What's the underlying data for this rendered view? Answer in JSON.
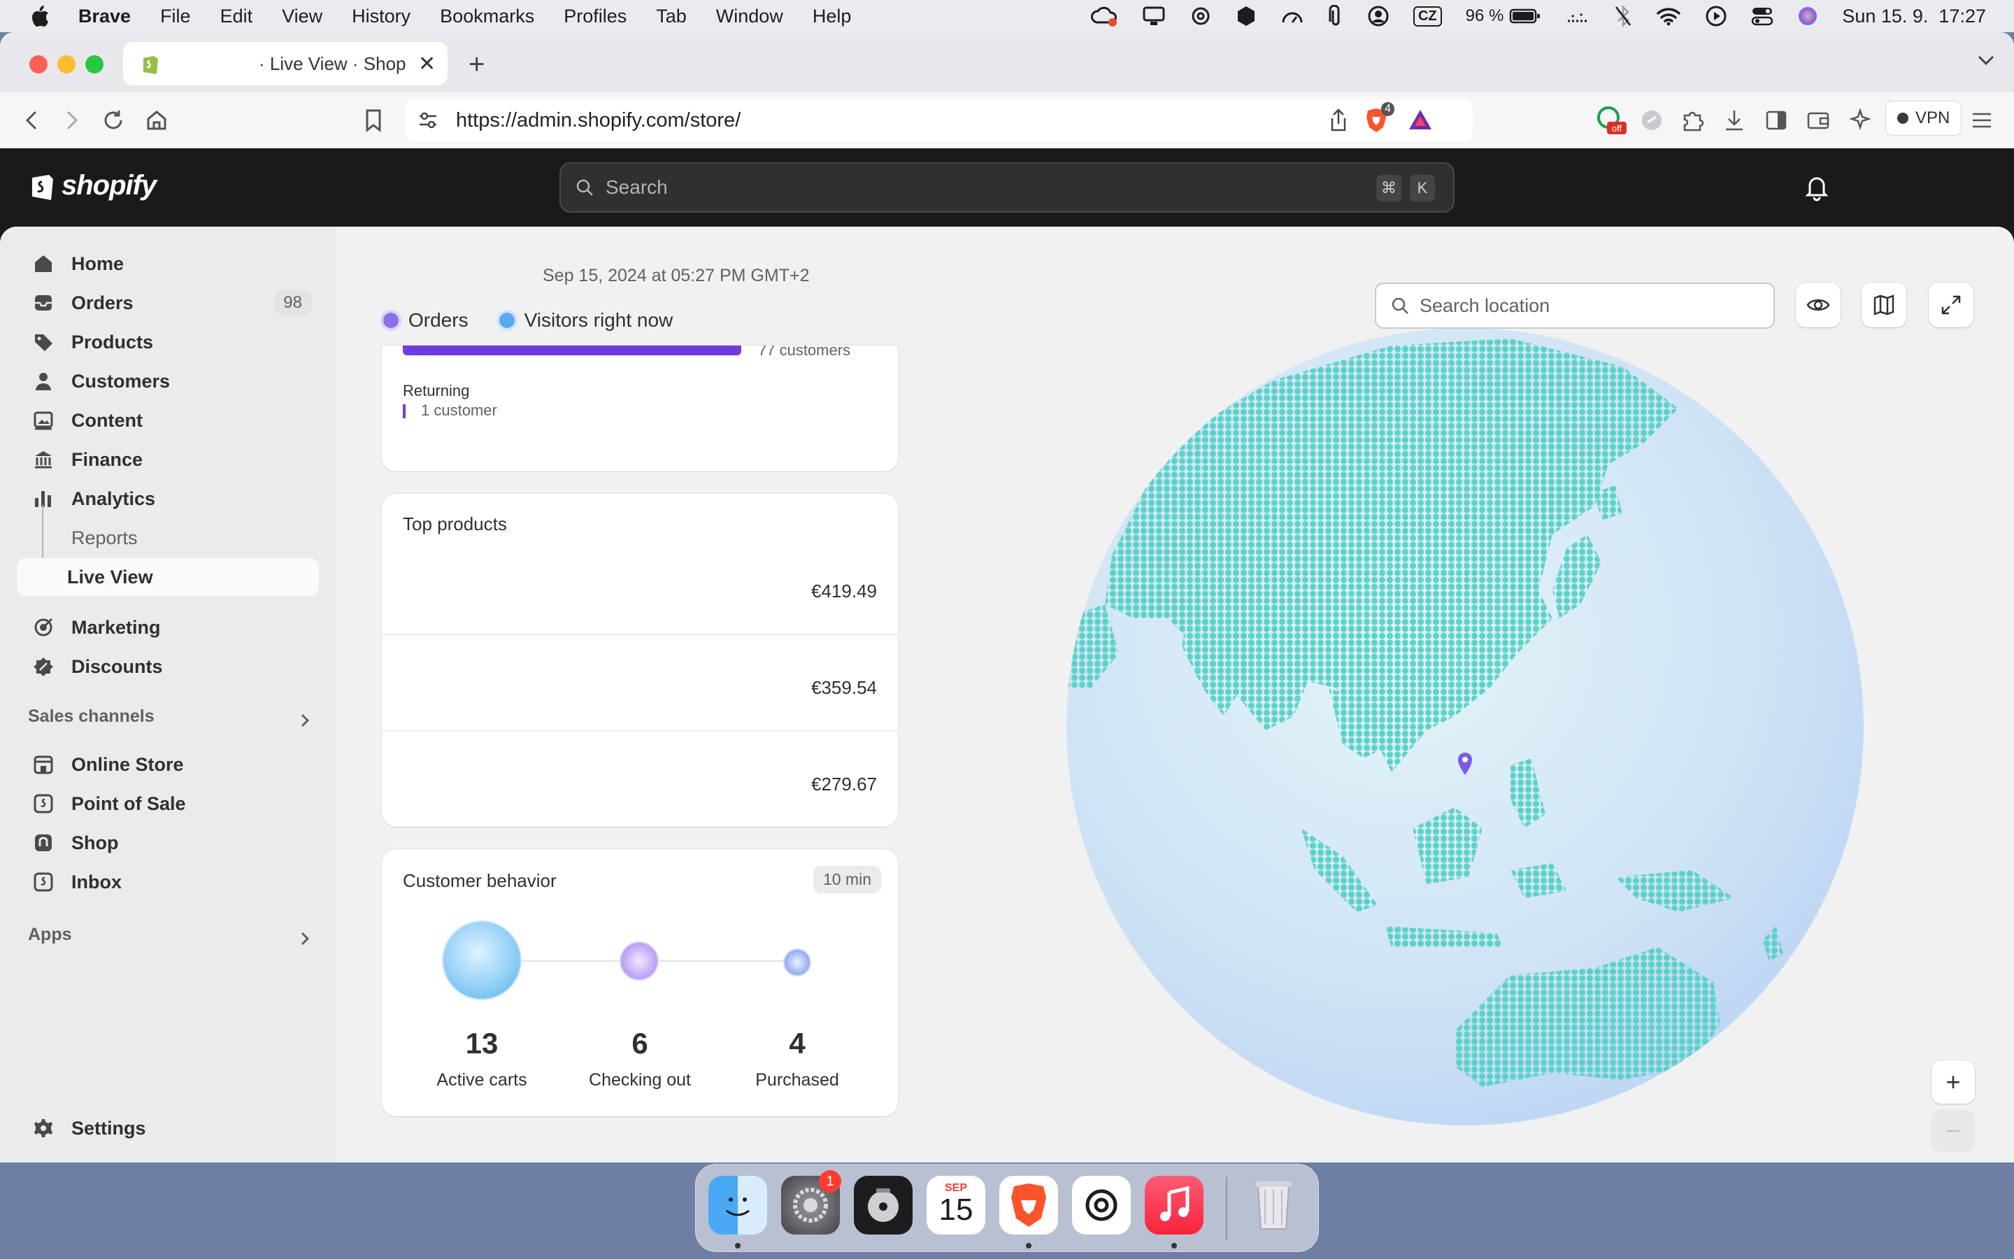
{
  "menubar": {
    "app_name": "Brave",
    "items": [
      "File",
      "Edit",
      "View",
      "History",
      "Bookmarks",
      "Profiles",
      "Tab",
      "Window",
      "Help"
    ],
    "keyboard_layout": "CZ",
    "battery": "96 %",
    "datetime": "Sun 15. 9.  17:27"
  },
  "browser": {
    "tab_title": "· Live View · Shopify",
    "url": "https://admin.shopify.com/store/",
    "shield_count": "4",
    "vpn_label": "VPN"
  },
  "shopify": {
    "logo_text": "shopify",
    "search_placeholder": "Search",
    "search_kbd_1": "⌘",
    "search_kbd_2": "K"
  },
  "sidebar": {
    "home": "Home",
    "orders": "Orders",
    "orders_count": "98",
    "products": "Products",
    "customers": "Customers",
    "content": "Content",
    "finance": "Finance",
    "analytics": "Analytics",
    "reports": "Reports",
    "live_view": "Live View",
    "marketing": "Marketing",
    "discounts": "Discounts",
    "sales_channels_title": "Sales channels",
    "online_store": "Online Store",
    "point_of_sale": "Point of Sale",
    "shop": "Shop",
    "inbox": "Inbox",
    "apps_title": "Apps",
    "settings": "Settings"
  },
  "main": {
    "datestamp": "Sep 15, 2024 at 05:27 PM GMT+2",
    "legend_orders": "Orders",
    "legend_visitors": "Visitors right now",
    "new_customers_label": "77 customers",
    "returning_title": "Returning",
    "returning_value": "1 customer",
    "top_products_title": "Top products",
    "top_products": [
      {
        "price": "€419.49"
      },
      {
        "price": "€359.54"
      },
      {
        "price": "€279.67"
      }
    ],
    "behavior_title": "Customer behavior",
    "behavior_period": "10 min",
    "behavior": [
      {
        "value": "13",
        "label": "Active carts"
      },
      {
        "value": "6",
        "label": "Checking out"
      },
      {
        "value": "4",
        "label": "Purchased"
      }
    ],
    "location_search_placeholder": "Search location",
    "zoom_in": "+",
    "zoom_out": "−"
  },
  "dock": {
    "settings_badge": "1",
    "calendar_month": "SEP",
    "calendar_day": "15"
  },
  "colors": {
    "accent_purple": "#6e3ddf",
    "orders_dot": "#8b6fe8",
    "visitors_dot": "#5aa9f0",
    "globe_land": "#4fd1c5",
    "shopify_dark": "#1a1a1a"
  }
}
